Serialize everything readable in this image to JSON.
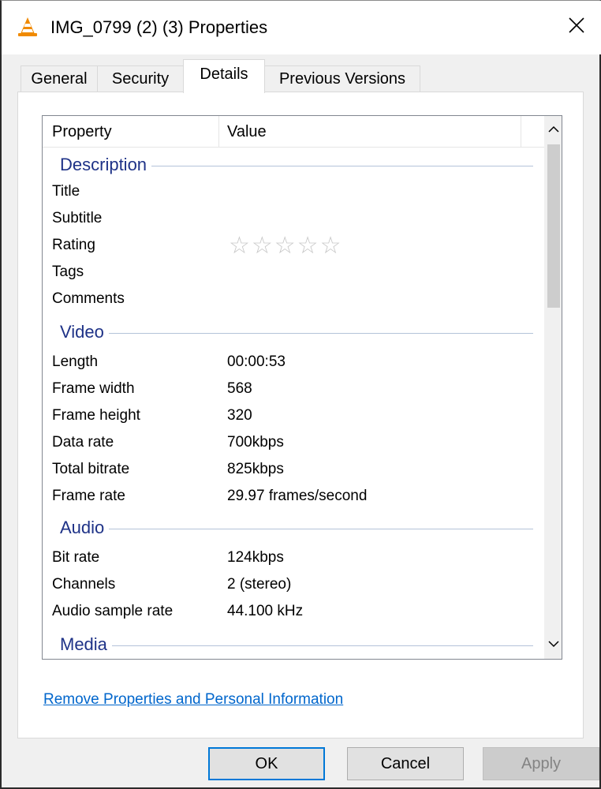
{
  "window": {
    "title": "IMG_0799 (2) (3) Properties",
    "icon": "vlc-cone-icon",
    "close_glyph": "✕"
  },
  "tabs": [
    {
      "label": "General",
      "active": false
    },
    {
      "label": "Security",
      "active": false
    },
    {
      "label": "Details",
      "active": true
    },
    {
      "label": "Previous Versions",
      "active": false
    }
  ],
  "details": {
    "columns": {
      "property": "Property",
      "value": "Value"
    },
    "groups": [
      {
        "title": "Description",
        "rows": [
          {
            "property": "Title",
            "value": ""
          },
          {
            "property": "Subtitle",
            "value": ""
          },
          {
            "property": "Rating",
            "value": "",
            "stars": "☆☆☆☆☆",
            "rating": 0,
            "rating_max": 5
          },
          {
            "property": "Tags",
            "value": ""
          },
          {
            "property": "Comments",
            "value": ""
          }
        ]
      },
      {
        "title": "Video",
        "rows": [
          {
            "property": "Length",
            "value": "00:00:53"
          },
          {
            "property": "Frame width",
            "value": "568"
          },
          {
            "property": "Frame height",
            "value": "320"
          },
          {
            "property": "Data rate",
            "value": "700kbps"
          },
          {
            "property": "Total bitrate",
            "value": "825kbps"
          },
          {
            "property": "Frame rate",
            "value": "29.97 frames/second"
          }
        ]
      },
      {
        "title": "Audio",
        "rows": [
          {
            "property": "Bit rate",
            "value": "124kbps"
          },
          {
            "property": "Channels",
            "value": "2 (stereo)"
          },
          {
            "property": "Audio sample rate",
            "value": "44.100 kHz"
          }
        ]
      },
      {
        "title": "Media",
        "rows": []
      }
    ]
  },
  "scrollbar": {
    "up_glyph": "⌃",
    "down_glyph": "⌄"
  },
  "link": {
    "label": "Remove Properties and Personal Information"
  },
  "buttons": {
    "ok": "OK",
    "cancel": "Cancel",
    "apply": "Apply"
  },
  "colors": {
    "accent": "#0078d7",
    "group_header": "#1e3287",
    "link": "#0066cc"
  }
}
